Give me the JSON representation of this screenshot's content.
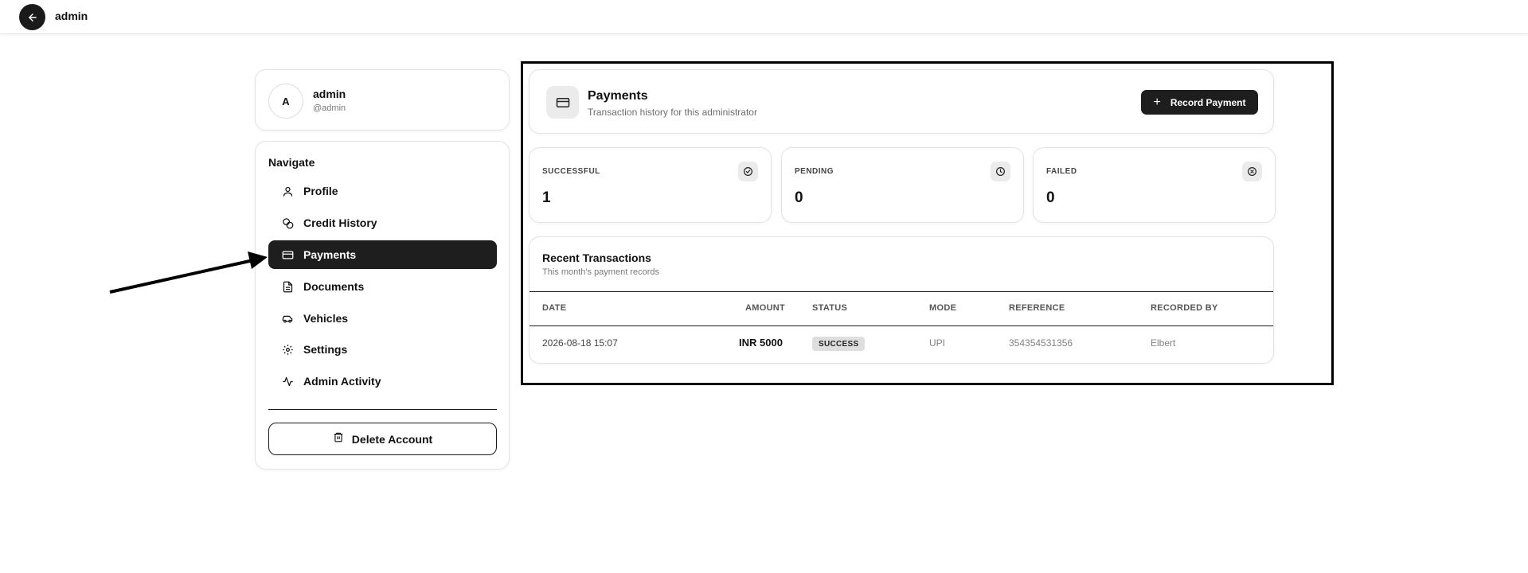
{
  "topbar": {
    "title": "admin"
  },
  "user": {
    "avatar_letter": "A",
    "name": "admin",
    "handle": "@admin"
  },
  "nav": {
    "title": "Navigate",
    "items": [
      {
        "label": "Profile",
        "icon": "user-icon"
      },
      {
        "label": "Credit History",
        "icon": "coins-icon"
      },
      {
        "label": "Payments",
        "icon": "credit-card-icon",
        "active": true
      },
      {
        "label": "Documents",
        "icon": "document-icon"
      },
      {
        "label": "Vehicles",
        "icon": "car-icon"
      },
      {
        "label": "Settings",
        "icon": "gear-icon"
      },
      {
        "label": "Admin Activity",
        "icon": "activity-icon"
      }
    ],
    "delete_label": "Delete Account"
  },
  "payments": {
    "title": "Payments",
    "subtitle": "Transaction history for this administrator",
    "record_label": "Record Payment"
  },
  "stats": [
    {
      "label": "SUCCESSFUL",
      "value": "1",
      "icon": "check-circle-icon"
    },
    {
      "label": "PENDING",
      "value": "0",
      "icon": "clock-icon"
    },
    {
      "label": "FAILED",
      "value": "0",
      "icon": "x-circle-icon"
    }
  ],
  "transactions": {
    "title": "Recent Transactions",
    "subtitle": "This month's payment records",
    "columns": [
      "DATE",
      "AMOUNT",
      "STATUS",
      "MODE",
      "REFERENCE",
      "RECORDED BY"
    ],
    "rows": [
      {
        "date": "2026-08-18 15:07",
        "amount": "INR 5000",
        "status": "SUCCESS",
        "mode": "UPI",
        "reference": "354354531356",
        "recorded_by": "Elbert"
      }
    ]
  },
  "colors": {
    "primary": "#1e1e1e",
    "muted_bg": "#ebebeb",
    "border": "#e3e3e3",
    "annotation": "#000000"
  }
}
